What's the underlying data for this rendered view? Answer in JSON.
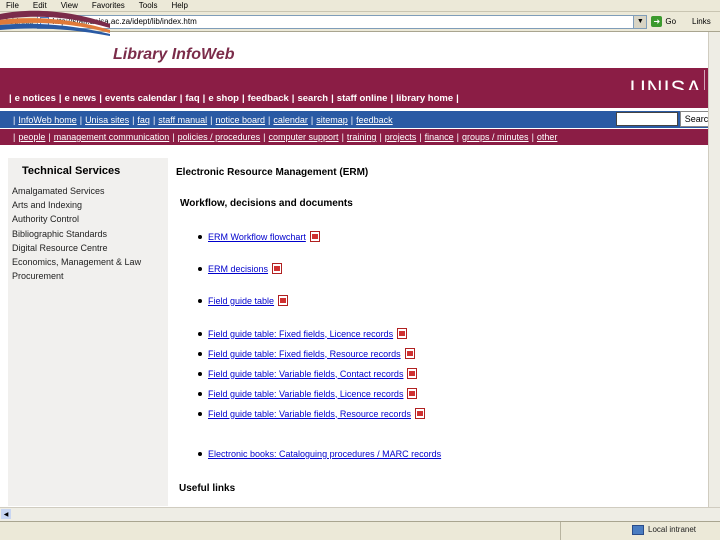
{
  "browser": {
    "menu": [
      "File",
      "Edit",
      "View",
      "Favorites",
      "Tools",
      "Help"
    ],
    "address_label": "Address",
    "url": "http://staff.unisa.ac.za/idept/lib/index.htm",
    "go_label": "Go",
    "links_label": "Links"
  },
  "header": {
    "site_title": "Library InfoWeb",
    "brand": "UNISA"
  },
  "nav_main": [
    "e notices",
    "e news",
    "events calendar",
    "faq",
    "e shop",
    "feedback",
    "search",
    "staff online",
    "library home"
  ],
  "nav_sub": [
    "InfoWeb home",
    "Unisa sites",
    "faq",
    "staff manual",
    "notice board",
    "calendar",
    "sitemap",
    "feedback"
  ],
  "search_button": "Search",
  "nav_topics": [
    "people",
    "management communication",
    "policies / procedures",
    "computer support",
    "training",
    "projects",
    "finance",
    "groups / minutes",
    "other"
  ],
  "sidebar": {
    "title": "Technical Services",
    "items": [
      "Amalgamated Services",
      "Arts and Indexing",
      "Authority Control",
      "Bibliographic Standards",
      "Digital Resource Centre",
      "Economics, Management & Law",
      "Procurement"
    ]
  },
  "main": {
    "title": "Electronic Resource Management (ERM)",
    "subtitle": "Workflow, decisions and documents",
    "documents": [
      "ERM Workflow flowchart",
      "ERM decisions",
      "Field guide table",
      "Field guide table: Fixed fields, Licence records",
      "Field guide table: Fixed fields, Resource records",
      "Field guide table: Variable fields, Contact records",
      "Field guide table: Variable fields, Licence records",
      "Field guide table: Variable fields, Resource records",
      "Electronic books: Cataloguing procedures / MARC records"
    ],
    "useful_links": "Useful links"
  },
  "status": {
    "zone": "Local intranet"
  },
  "colors": {
    "maroon": "#8b1d45",
    "nav_blue": "#2a5aa4",
    "link_blue": "#0000cc"
  }
}
